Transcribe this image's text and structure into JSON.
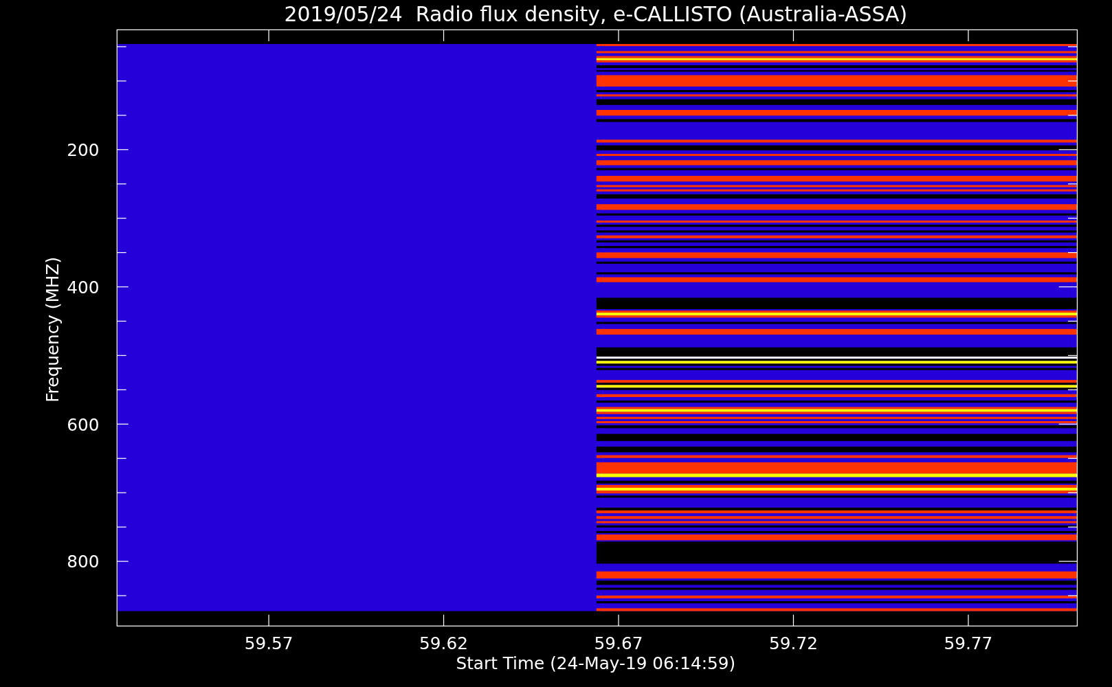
{
  "title": "2019/05/24  Radio flux density, e-CALLISTO (Australia-ASSA)",
  "y_axis": {
    "label": "Frequency (MHZ)",
    "ticks": [
      "200",
      "400",
      "600",
      "800"
    ]
  },
  "x_axis": {
    "label": "Start Time (24-May-19 06:14:59)",
    "ticks": [
      "59.57",
      "59.62",
      "59.67",
      "59.72",
      "59.77"
    ]
  }
}
